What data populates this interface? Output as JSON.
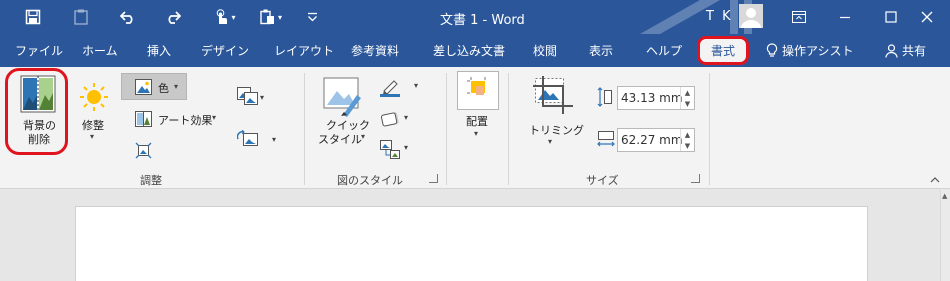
{
  "title_bar": {
    "doc_title": "文書 1  -  Word",
    "user_initials": "T K",
    "qat_icons": [
      "save-icon",
      "clipboard-icon",
      "undo-icon",
      "redo-icon",
      "touch-mode-icon",
      "paste-icon",
      "customize-icon"
    ],
    "window_controls": [
      "ribbon-display-icon",
      "minimize-icon",
      "maximize-icon",
      "close-icon"
    ]
  },
  "tabs": {
    "file": "ファイル",
    "home": "ホーム",
    "insert": "挿入",
    "design": "デザイン",
    "layout": "レイアウト",
    "references": "参考資料",
    "mailings": "差し込み文書",
    "review": "校閲",
    "view": "表示",
    "help": "ヘルプ",
    "format": "書式",
    "tell_me": "操作アシスト",
    "share": "共有"
  },
  "ribbon": {
    "adjust": {
      "remove_background_line1": "背景の",
      "remove_background_line2": "削除",
      "corrections": "修整",
      "color": "色",
      "artistic_effects": "アート効果",
      "group_label": "調整"
    },
    "picture_styles": {
      "quick_styles_line1": "クイック",
      "quick_styles_line2": "スタイル",
      "group_label": "図のスタイル"
    },
    "arrange": {
      "position": "配置"
    },
    "size": {
      "crop": "トリミング",
      "height_value": "43.13 mm",
      "width_value": "62.27 mm",
      "group_label": "サイズ"
    }
  },
  "colors": {
    "title_bar": "#2b579a",
    "ribbon_bg": "#f3f3f3",
    "highlight": "#e0141e",
    "doc_bg": "#e6e6e6"
  }
}
